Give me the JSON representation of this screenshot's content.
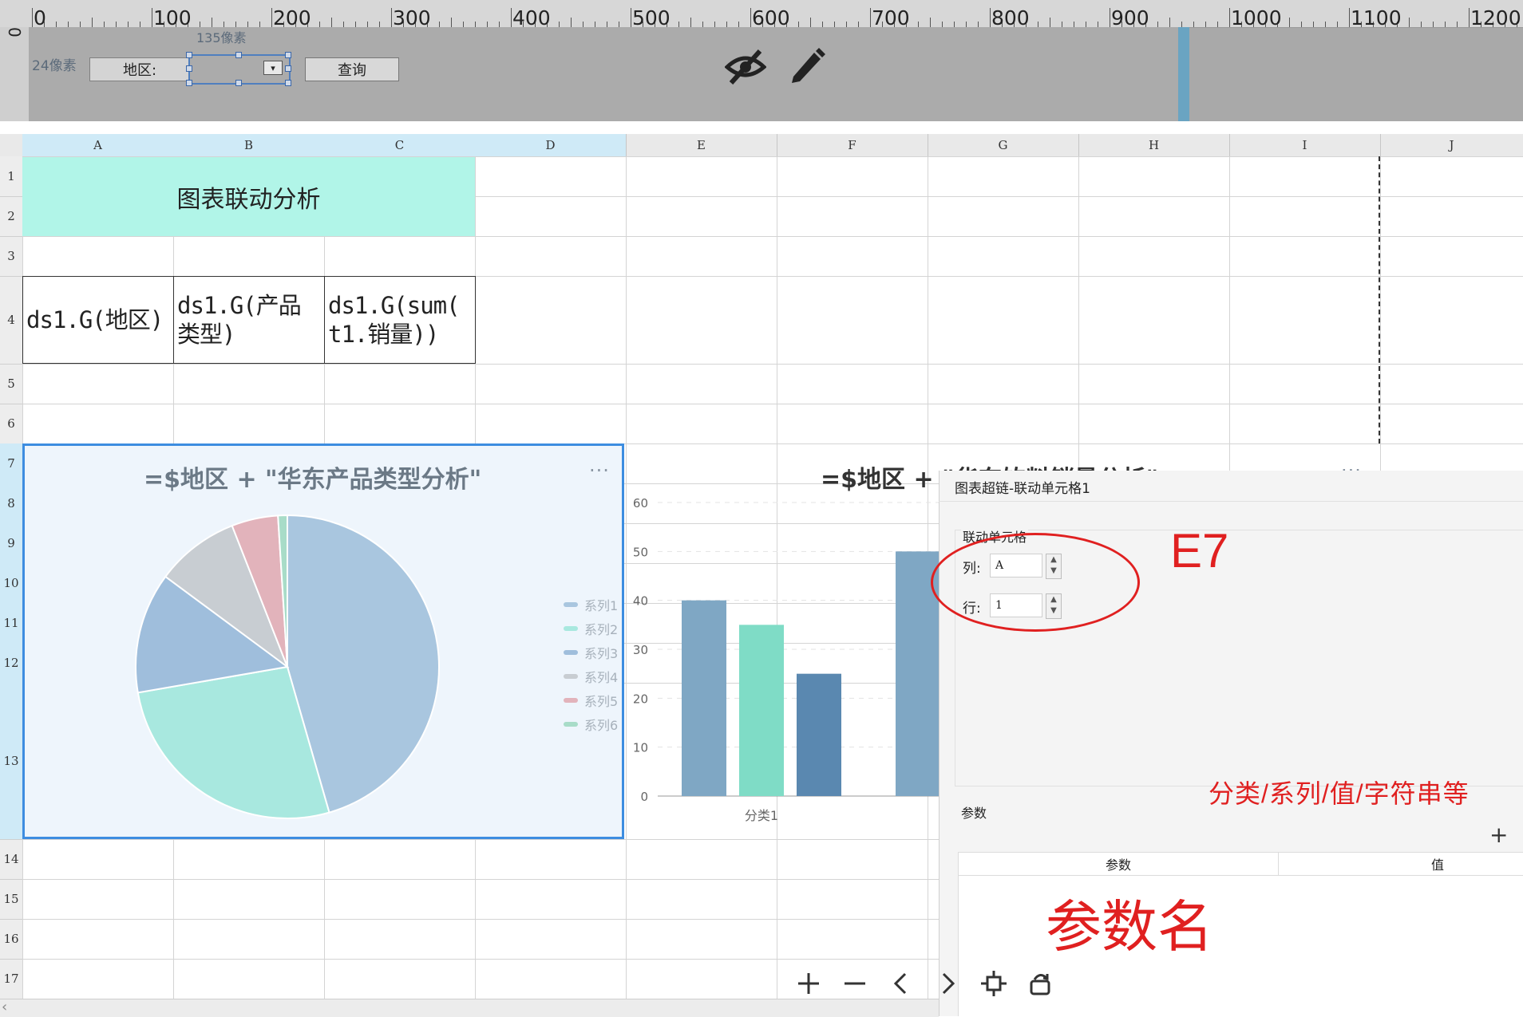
{
  "ruler": {
    "marks": [
      "0",
      "100",
      "200",
      "300",
      "400",
      "500",
      "600",
      "700",
      "800",
      "900",
      "1000",
      "1100",
      "1200"
    ],
    "vertical_zero": "0"
  },
  "param_pane": {
    "height_label": "24像素",
    "width_label": "135像素",
    "region_label": "地区:",
    "combo_value": "",
    "query_button": "查询",
    "eye_icon": "eye-slash-icon",
    "pencil_icon": "pencil-icon"
  },
  "sheet": {
    "columns": [
      "A",
      "B",
      "C",
      "D",
      "E",
      "F",
      "G",
      "H",
      "I",
      "J"
    ],
    "rows": [
      "1",
      "2",
      "3",
      "4",
      "5",
      "6",
      "7",
      "8",
      "9",
      "10",
      "11",
      "12",
      "13",
      "14",
      "15",
      "16",
      "17"
    ],
    "title_cell": "图表联动分析",
    "ds_cells": [
      {
        "line1": "ds1.G(地区)",
        "line2": ""
      },
      {
        "line1": "ds1.G(产品",
        "line2": "类型)"
      },
      {
        "line1": "ds1.G(sum(",
        "line2": "t1.销量))"
      }
    ]
  },
  "pie_chart": {
    "title": "=$地区 + \"华东产品类型分析\"",
    "menu": "···",
    "legend": [
      "系列1",
      "系列2",
      "系列3",
      "系列4",
      "系列5",
      "系列6"
    ]
  },
  "bar_chart": {
    "title": "=$地区 + \"华东饮料销量分析\"",
    "menu": "···"
  },
  "chart_data": [
    {
      "type": "pie",
      "title": "=$地区 + \"华东产品类型分析\"",
      "legend_position": "right",
      "categories": [
        "系列1",
        "系列2",
        "系列3",
        "系列4",
        "系列5",
        "系列6"
      ],
      "values": [
        46,
        27,
        13,
        9,
        5,
        1
      ],
      "colors": [
        "#a9c6df",
        "#a8e8df",
        "#9fbedc",
        "#c8cdd2",
        "#e2b3bb",
        "#a8dcc8"
      ]
    },
    {
      "type": "bar",
      "title": "=$地区 + \"华东饮料销量分析\"",
      "ylim": [
        0,
        60
      ],
      "yticks": [
        "0",
        "10",
        "20",
        "30",
        "40",
        "50",
        "60"
      ],
      "categories": [
        "分类1"
      ],
      "series": [
        {
          "values": [
            40
          ],
          "color": "#7fa7c4"
        },
        {
          "values": [
            35
          ],
          "color": "#7fdcc6"
        },
        {
          "values": [
            25
          ],
          "color": "#5a88b0"
        },
        {
          "values": [
            50
          ],
          "color": "#7fa7c4"
        }
      ]
    }
  ],
  "dialog": {
    "title": "图表超链-联动单元格1",
    "group_label": "联动单元格",
    "col_label": "列:",
    "col_value": "A",
    "row_label": "行:",
    "row_value": "1",
    "params_label": "参数",
    "add": "+",
    "table_headers": [
      "参数",
      "值"
    ]
  },
  "annotations": {
    "e7": "E7",
    "types": "分类/系列/值/字符串等",
    "param_name": "参数名",
    "color": "#e02020"
  },
  "toolbar": {
    "icons": [
      "plus-icon",
      "minus-icon",
      "chevron-left-icon",
      "chevron-right-icon",
      "fit-icon",
      "rotate-icon"
    ]
  }
}
